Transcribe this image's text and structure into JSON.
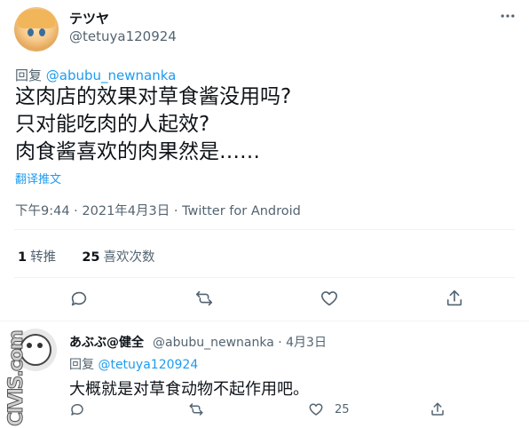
{
  "main_tweet": {
    "display_name": "テツヤ",
    "handle": "@tetuya120924",
    "reply_prefix": "回复",
    "reply_to": "@abubu_newnanka",
    "text": "这肉店的效果对草食酱没用吗?\n只对能吃肉的人起效?\n肉食酱喜欢的肉果然是……",
    "translate_label": "翻译推文",
    "timestamp": "下午9:44 · 2021年4月3日 · Twitter for Android",
    "retweet_count": "1",
    "retweet_label": "转推",
    "like_count": "25",
    "like_label": "喜欢次数"
  },
  "reply_tweet": {
    "display_name": "あぶぶ@健全",
    "handle_date": "@abubu_newnanka · 4月3日",
    "reply_prefix": "回复",
    "reply_to": "@tetuya120924",
    "text": "大概就是对草食动物不起作用吧。",
    "like_count": "25"
  },
  "watermark": "CIVIS.com",
  "colors": {
    "link": "#1d9bf0",
    "secondary_text": "#536471",
    "primary_text": "#0f1419",
    "divider": "#eff3f4"
  },
  "icons": [
    "more-icon",
    "reply-icon",
    "retweet-icon",
    "like-icon",
    "share-icon"
  ]
}
